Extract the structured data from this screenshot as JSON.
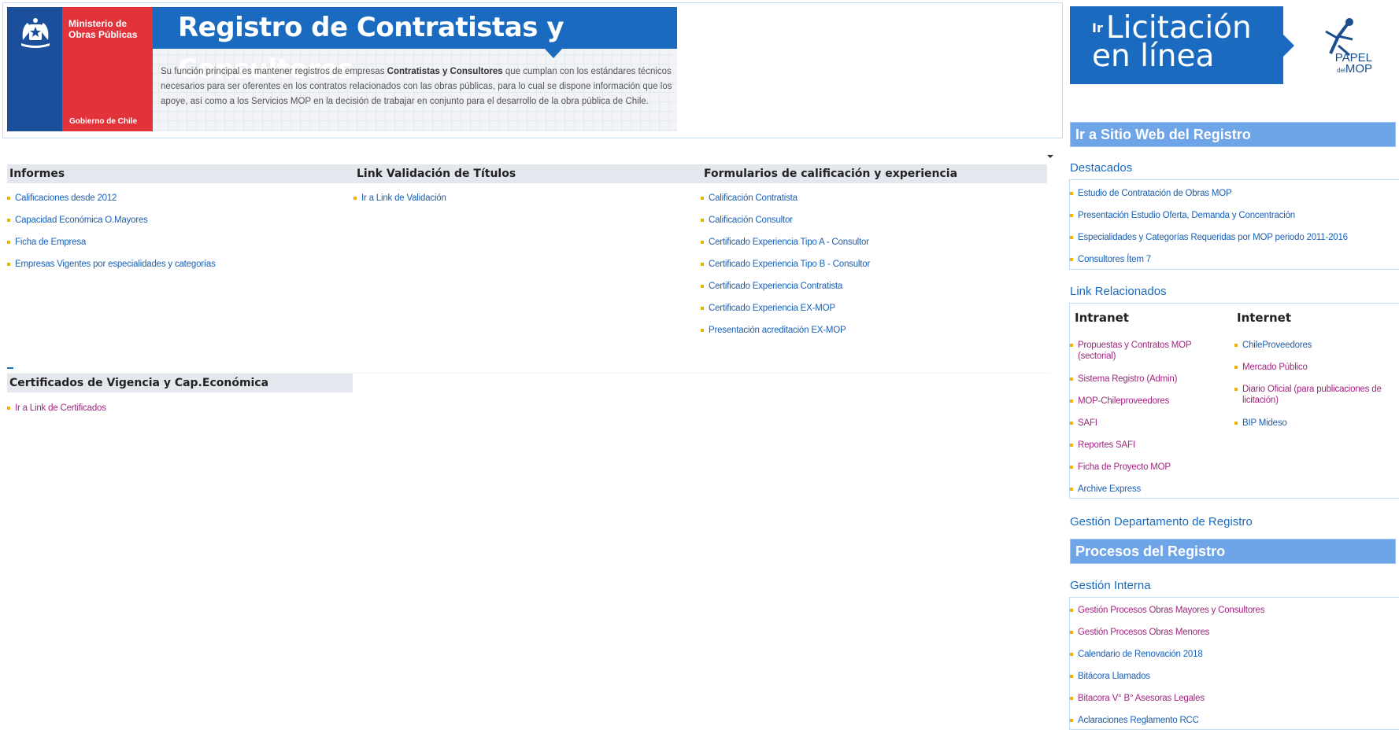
{
  "banner": {
    "ministry_line1": "Ministerio de",
    "ministry_line2": "Obras Públicas",
    "gobierno": "Gobierno de Chile",
    "title": "Registro de Contratistas y Consultores",
    "desc_pre": "Su función principal es mantener registros de empresas ",
    "desc_bold": "Contratistas y Consultores",
    "desc_post": " que cumplan con los estándares técnicos necesarios para ser oferentes en los contratos relacionados con las obras públicas, para lo cual se dispone información que los apoye, así como a los Servicios MOP en la decisión de trabajar en conjunto para el desarrollo de la obra pública de Chile."
  },
  "ad": {
    "ir": "Ir",
    "line1": "Licitación",
    "line2": "en línea",
    "papel": "PAPEL",
    "del": "del",
    "mop": "MOP"
  },
  "informes": {
    "title": "Informes",
    "items": [
      "Calificaciones desde 2012",
      "Capacidad Económica O.Mayores",
      "Ficha de Empresa",
      "Empresas Vigentes por especialidades y categorías"
    ]
  },
  "validacion": {
    "title": "Link Validación de Títulos",
    "items": [
      "Ir a Link de Validación"
    ]
  },
  "formularios": {
    "title": "Formularios de calificación y experiencia",
    "items": [
      "Calificación Contratista",
      "Calificación Consultor",
      "Certificado Experiencia Tipo A - Consultor",
      "Certificado Experiencia Tipo B - Consultor",
      "Certificado Experiencia Contratista",
      "Certificado Experiencia EX-MOP",
      "Presentación acreditación EX-MOP"
    ]
  },
  "certificados": {
    "title": "Certificados de Vigencia y Cap.Económica",
    "items": [
      "Ir a Link de Certificados"
    ]
  },
  "right": {
    "sitio_web": "Ir a Sitio Web del Registro",
    "destacados": {
      "title": "Destacados",
      "items": [
        "Estudio de Contratación de Obras MOP",
        "Presentación Estudio Oferta, Demanda y Concentración",
        "Especialidades y Categorías Requeridas por MOP periodo 2011-2016",
        "Consultores Ítem 7"
      ]
    },
    "relacionados": {
      "title": "Link Relacionados",
      "intranet_title": "Intranet",
      "internet_title": "Internet",
      "intranet": [
        "Propuestas y Contratos MOP (sectorial)",
        "Sistema Registro (Admin)",
        "MOP-Chileproveedores",
        "SAFI",
        "Reportes SAFI",
        "Ficha de Proyecto MOP",
        "Archive Express"
      ],
      "internet": [
        "ChileProveedores",
        "Mercado Público",
        "Diario Oficial (para publicaciones de licitación)",
        "BIP Mideso"
      ]
    },
    "gestion_depto": "Gestión Departamento de Registro",
    "procesos": "Procesos del Registro",
    "gestion_interna": {
      "title": "Gestión Interna",
      "items": [
        "Gestión Procesos Obras Mayores y Consultores",
        "Gestión Procesos Obras Menores",
        "Calendario de Renovación 2018",
        "Bitácora Llamados",
        "Bitacora V° B° Asesoras Legales",
        "Aclaraciones Reglamento RCC"
      ]
    }
  },
  "colors": {
    "blue": "#1a6bbf",
    "red": "#e2333b",
    "link": "#1a5fb4",
    "link_visited": "#a0267e",
    "bullet": "#f0b000"
  }
}
